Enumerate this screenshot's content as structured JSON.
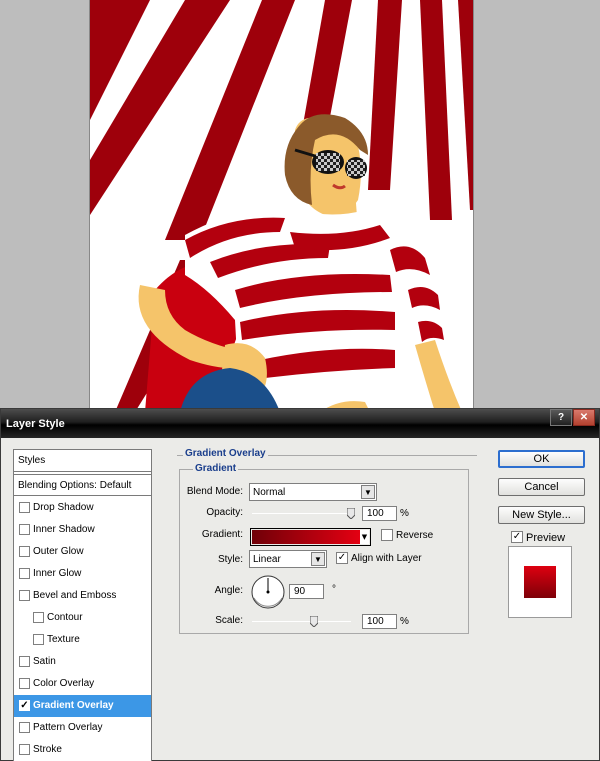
{
  "dialog": {
    "title": "Layer Style"
  },
  "styles_panel": {
    "header": "Styles",
    "blending": "Blending Options: Default",
    "items": [
      {
        "label": "Drop Shadow",
        "checked": false
      },
      {
        "label": "Inner Shadow",
        "checked": false
      },
      {
        "label": "Outer Glow",
        "checked": false
      },
      {
        "label": "Inner Glow",
        "checked": false
      },
      {
        "label": "Bevel and Emboss",
        "checked": false
      },
      {
        "label": "Contour",
        "checked": false
      },
      {
        "label": "Texture",
        "checked": false
      },
      {
        "label": "Satin",
        "checked": false
      },
      {
        "label": "Color Overlay",
        "checked": false
      },
      {
        "label": "Gradient Overlay",
        "checked": true
      },
      {
        "label": "Pattern Overlay",
        "checked": false
      },
      {
        "label": "Stroke",
        "checked": false
      }
    ]
  },
  "gradient_overlay": {
    "section_title": "Gradient Overlay",
    "group_title": "Gradient",
    "blend_mode_label": "Blend Mode:",
    "blend_mode_value": "Normal",
    "opacity_label": "Opacity:",
    "opacity_value": "100",
    "opacity_unit": "%",
    "gradient_label": "Gradient:",
    "gradient_colors": [
      "#700008",
      "#e40012"
    ],
    "reverse_label": "Reverse",
    "reverse_checked": false,
    "style_label": "Style:",
    "style_value": "Linear",
    "align_label": "Align with Layer",
    "align_checked": true,
    "angle_label": "Angle:",
    "angle_value": "90",
    "angle_unit": "°",
    "scale_label": "Scale:",
    "scale_value": "100",
    "scale_unit": "%"
  },
  "buttons": {
    "ok": "OK",
    "cancel": "Cancel",
    "new_style": "New Style...",
    "preview_label": "Preview",
    "preview_checked": true
  },
  "colors": {
    "accent_selection": "#3c97e6",
    "stripe_red": "#a8000c",
    "skin": "#f5c46a",
    "hair": "#8b5a2b",
    "jeans": "#1b4f8a"
  }
}
